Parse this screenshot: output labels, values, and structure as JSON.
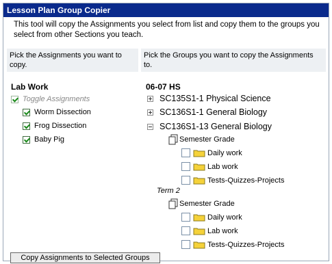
{
  "panel": {
    "title": "Lesson Plan Group Copier",
    "intro": "This tool will copy the Assignments you select from list and copy them to the groups you select from other Sections you teach."
  },
  "headers": {
    "left": "Pick the Assignments you want to copy.",
    "right": "Pick the Groups you want to copy the Assignments to."
  },
  "assignments": {
    "group_title": "Lab Work",
    "toggle_label": "Toggle Assignments",
    "items": [
      {
        "label": "Worm Dissection",
        "checked": true
      },
      {
        "label": "Frog Dissection",
        "checked": true
      },
      {
        "label": "Baby Pig",
        "checked": true
      }
    ]
  },
  "groups": {
    "year_title": "06-07 HS",
    "courses": [
      {
        "label": "SC135S1-1 Physical Science",
        "expanded": false
      },
      {
        "label": "SC136S1-1 General Biology",
        "expanded": false
      },
      {
        "label": "SC136S1-13 General Biology",
        "expanded": true
      }
    ],
    "semester_grade_label": "Semester Grade",
    "term_label": "Term 2",
    "categories": [
      "Daily work",
      "Lab work",
      "Tests-Quizzes-Projects"
    ]
  },
  "actions": {
    "copy_button": "Copy Assignments to Selected Groups"
  },
  "colors": {
    "title_bar": "#0a2a8c",
    "header_bg": "#edf0f3",
    "check_green": "#1b8a1b",
    "folder_yellow": "#f5d23a"
  }
}
